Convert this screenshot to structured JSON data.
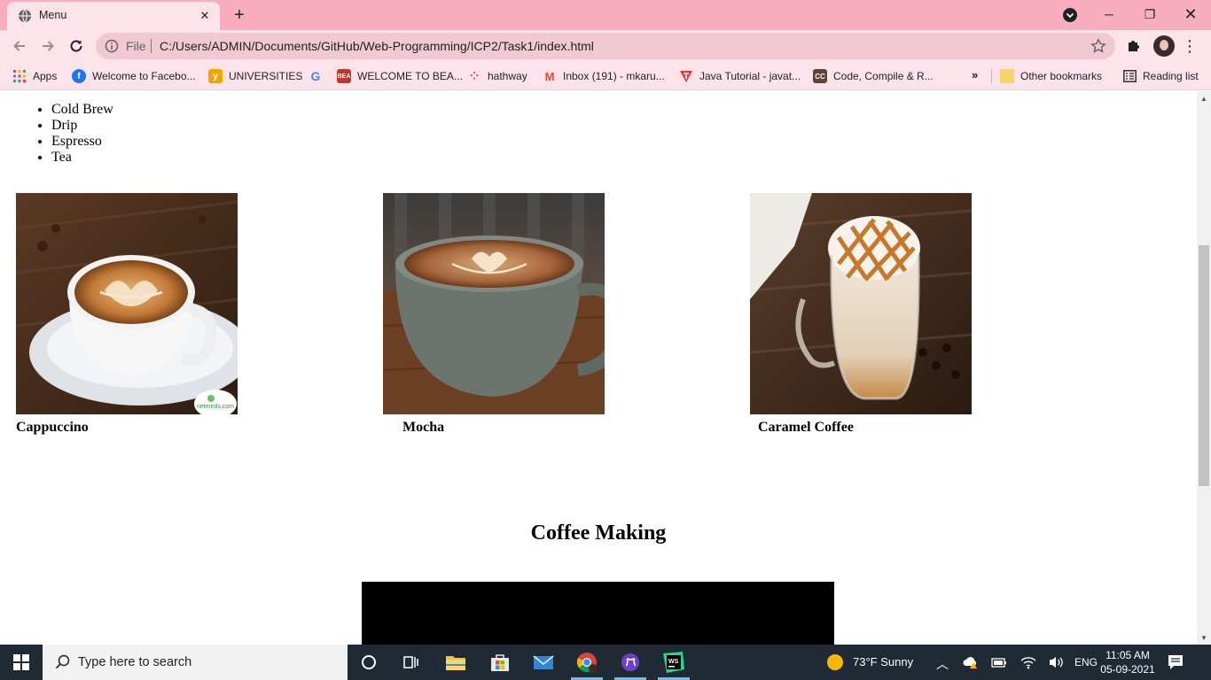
{
  "browser": {
    "tab_title": "Menu",
    "url_scheme": "File",
    "url": "C:/Users/ADMIN/Documents/GitHub/Web-Programming/ICP2/Task1/index.html",
    "bookmarks": [
      {
        "label": "Apps",
        "icon": "apps-grid-icon"
      },
      {
        "label": "Welcome to Facebo...",
        "icon": "facebook-icon"
      },
      {
        "label": "UNIVERSITIES",
        "icon": "universities-icon"
      },
      {
        "label": "",
        "icon": "google-icon"
      },
      {
        "label": "WELCOME TO BEA...",
        "icon": "bea-icon"
      },
      {
        "label": "hathway",
        "icon": "hathway-icon"
      },
      {
        "label": "Inbox (191) - mkaru...",
        "icon": "gmail-icon"
      },
      {
        "label": "Java Tutorial - javat...",
        "icon": "javatpoint-icon"
      },
      {
        "label": "Code, Compile & R...",
        "icon": "codechef-icon"
      }
    ],
    "other_bookmarks": "Other bookmarks",
    "reading_list": "Reading list"
  },
  "page": {
    "menu_items": [
      "Cold Brew",
      "Drip",
      "Espresso",
      "Tea"
    ],
    "products": [
      {
        "name": "Cappuccino"
      },
      {
        "name": "Mocha"
      },
      {
        "name": "Caramel Coffee"
      }
    ],
    "heading": "Coffee Making",
    "watermark": "netmeds.com"
  },
  "taskbar": {
    "search_placeholder": "Type here to search",
    "weather": "73°F  Sunny",
    "language": "ENG",
    "time": "11:05 AM",
    "date": "05-09-2021"
  }
}
